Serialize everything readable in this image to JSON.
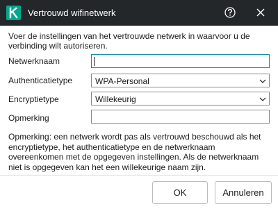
{
  "dialog": {
    "title": "Vertrouwd wifinetwerk",
    "logo_icon": "kaspersky-k-logo",
    "help_icon": "help-icon",
    "close_icon": "close-icon",
    "accent_color": "#00a88e",
    "titlebar_color": "#23272a"
  },
  "intro": "Voer de instellingen van het vertrouwde netwerk in waarvoor u de verbinding wilt autoriseren.",
  "form": {
    "network_name": {
      "label": "Netwerknaam",
      "value": ""
    },
    "auth_type": {
      "label": "Authenticatietype",
      "value": "WPA-Personal"
    },
    "encryption_type": {
      "label": "Encryptietype",
      "value": "Willekeurig"
    },
    "comment": {
      "label": "Opmerking",
      "value": ""
    }
  },
  "note": "Opmerking: een netwerk wordt pas als vertrouwd beschouwd als het encryptietype, het authenticatietype en de netwerknaam overeenkomen met de opgegeven instellingen. Als de netwerknaam niet is opgegeven kan het een willekeurige naam zijn.",
  "buttons": {
    "ok": "OK",
    "cancel": "Annuleren"
  }
}
